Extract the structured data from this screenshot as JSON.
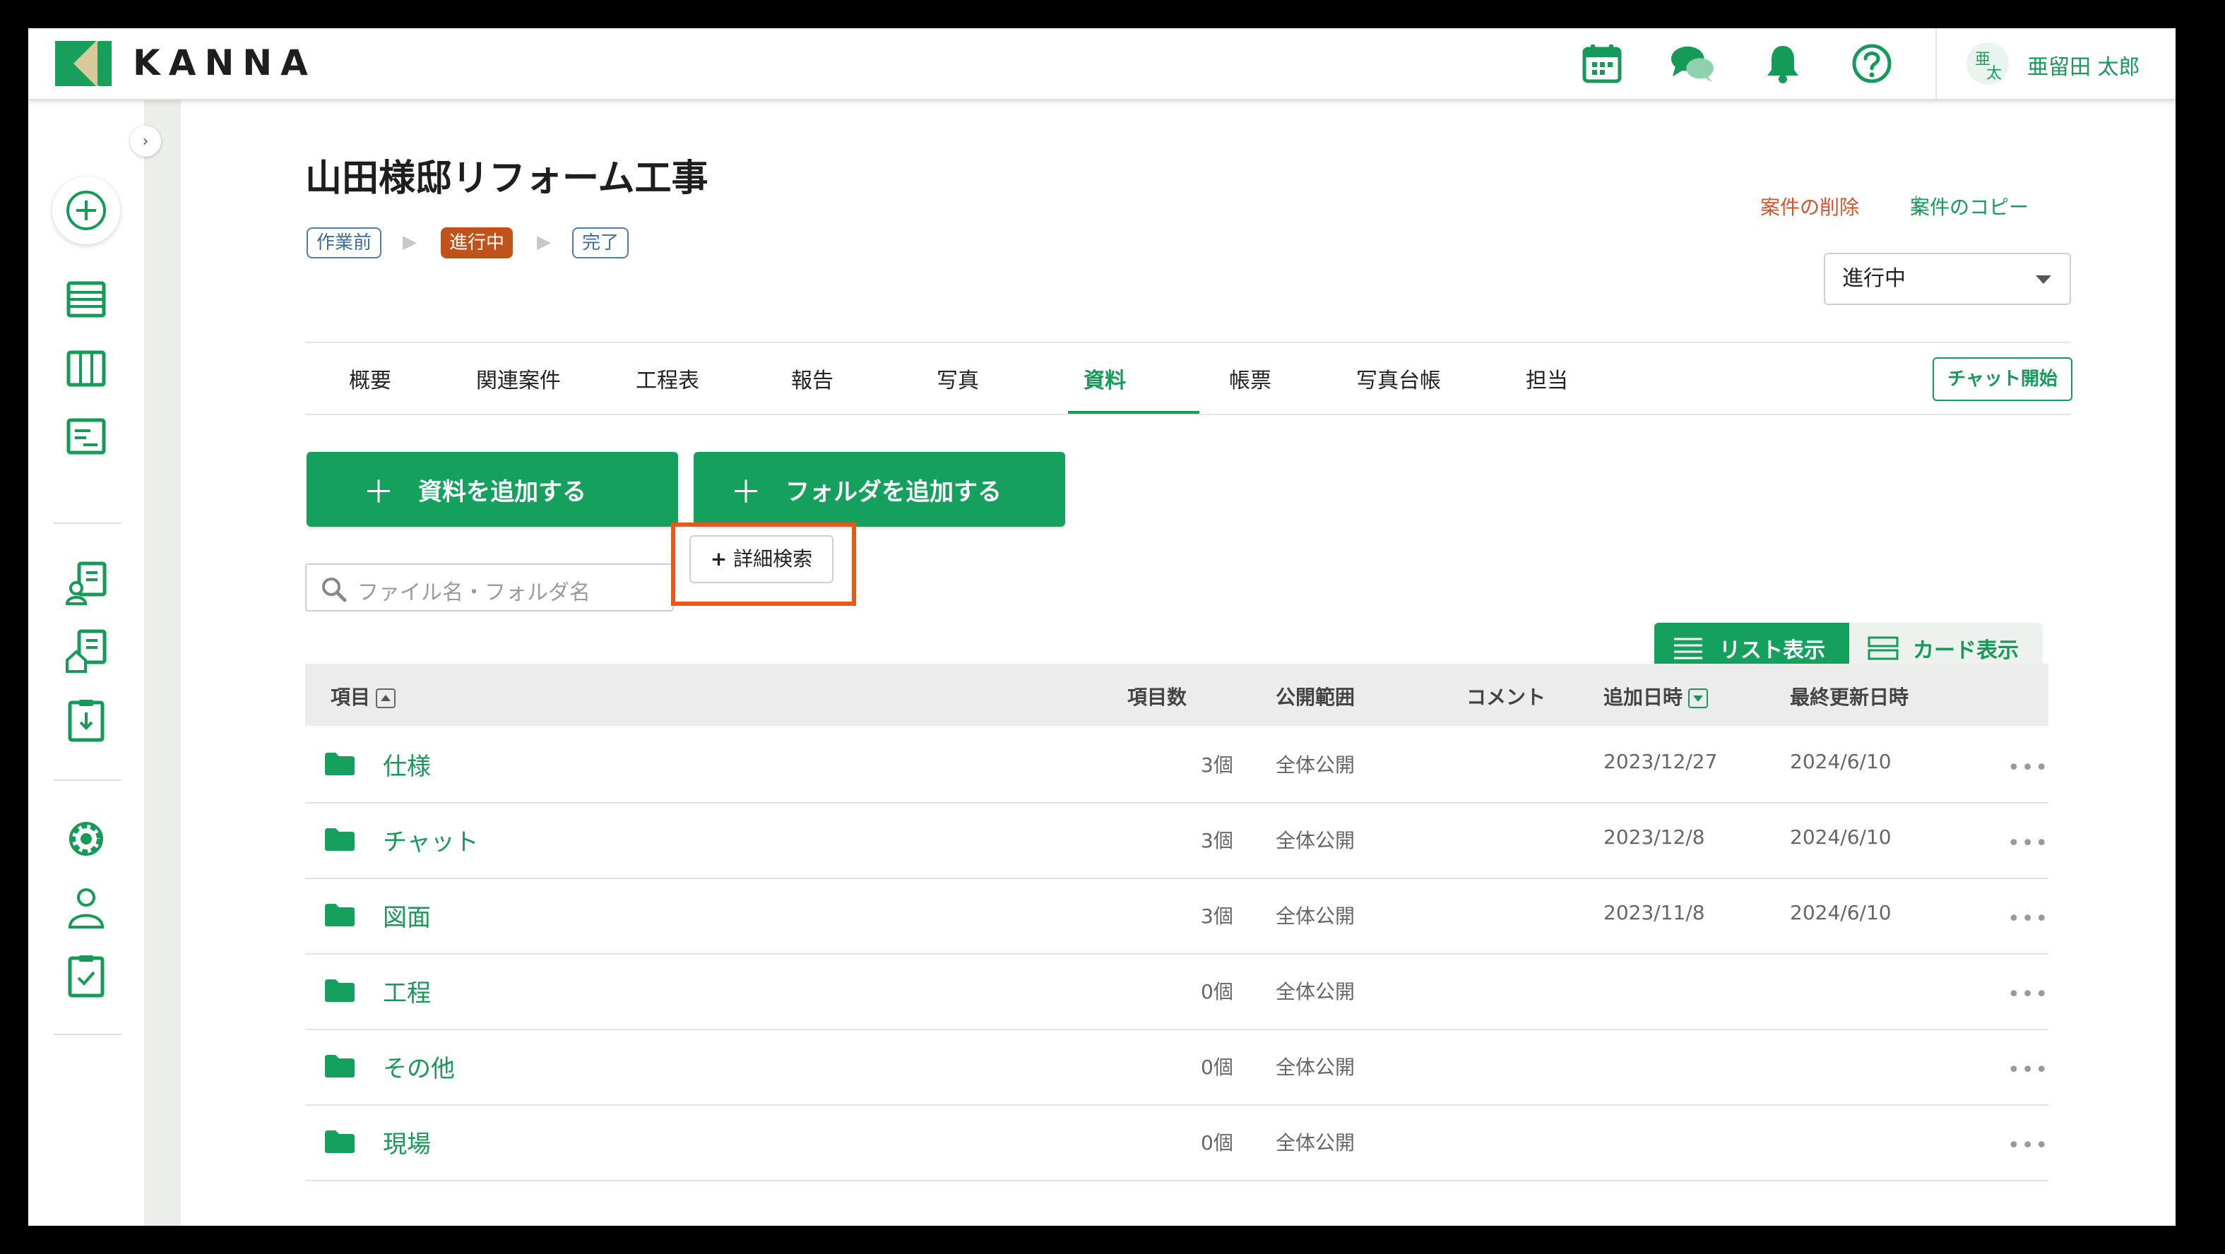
{
  "brand": {
    "logo_text": "KANNA",
    "green": "#16a05e",
    "accent_orange": "#e8581a"
  },
  "header": {
    "icons": [
      "calendar-icon",
      "chat-icon",
      "bell-icon",
      "help-icon"
    ],
    "avatar_top": "亜",
    "avatar_bottom": "太",
    "user_name": "亜留田 太郎"
  },
  "sidebar": {
    "items": [
      "add-icon",
      "list-icon",
      "board-icon",
      "report-icon",
      "customer-icon",
      "property-icon",
      "download-doc-icon",
      "settings-icon",
      "user-icon",
      "checklist-icon"
    ]
  },
  "project": {
    "title": "山田様邸リフォーム工事",
    "steps": [
      "作業前",
      "進行中",
      "完了"
    ],
    "delete_link": "案件の削除",
    "link_separator": "|",
    "copy_link": "案件のコピー",
    "status_select": "進行中"
  },
  "tabs": [
    "概要",
    "関連案件",
    "工程表",
    "報告",
    "写真",
    "資料",
    "帳票",
    "写真台帳",
    "担当"
  ],
  "active_tab": "資料",
  "chat_button": "チャット開始",
  "actions": {
    "add_file": "資料を追加する",
    "add_folder": "フォルダを追加する",
    "search_placeholder": "ファイル名・フォルダ名",
    "advanced_search": "詳細検索"
  },
  "view": {
    "list": "リスト表示",
    "card": "カード表示"
  },
  "table": {
    "headers": [
      "項目",
      "項目数",
      "公開範囲",
      "コメント",
      "追加日時",
      "最終更新日時"
    ],
    "rows": [
      {
        "name": "仕様",
        "count": "3個",
        "scope": "全体公開",
        "added": "2023/12/27",
        "updated": "2024/6/10"
      },
      {
        "name": "チャット",
        "count": "3個",
        "scope": "全体公開",
        "added": "2023/12/8",
        "updated": "2024/6/10"
      },
      {
        "name": "図面",
        "count": "3個",
        "scope": "全体公開",
        "added": "2023/11/8",
        "updated": "2024/6/10"
      },
      {
        "name": "工程",
        "count": "0個",
        "scope": "全体公開",
        "added": "",
        "updated": ""
      },
      {
        "name": "その他",
        "count": "0個",
        "scope": "全体公開",
        "added": "",
        "updated": ""
      },
      {
        "name": "現場",
        "count": "0個",
        "scope": "全体公開",
        "added": "",
        "updated": ""
      }
    ]
  }
}
